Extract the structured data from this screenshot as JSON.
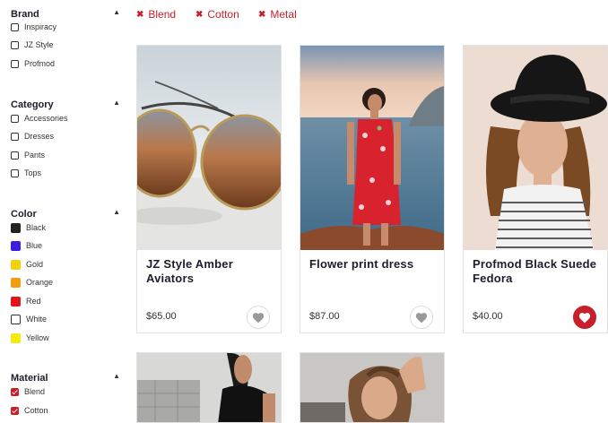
{
  "filters_chips": [
    "Blend",
    "Cotton",
    "Metal"
  ],
  "sidebar": {
    "brand": {
      "title": "Brand",
      "options": [
        {
          "label": "Inspiracy",
          "checked": false
        },
        {
          "label": "JZ Style",
          "checked": false
        },
        {
          "label": "Profmod",
          "checked": false
        }
      ]
    },
    "category": {
      "title": "Category",
      "options": [
        {
          "label": "Accessories",
          "checked": false
        },
        {
          "label": "Dresses",
          "checked": false
        },
        {
          "label": "Pants",
          "checked": false
        },
        {
          "label": "Tops",
          "checked": false
        }
      ]
    },
    "color": {
      "title": "Color",
      "options": [
        {
          "label": "Black",
          "swatch": "#222222"
        },
        {
          "label": "Blue",
          "swatch": "#3a1fe0"
        },
        {
          "label": "Gold",
          "swatch": "#f2d20a"
        },
        {
          "label": "Orange",
          "swatch": "#f39c12"
        },
        {
          "label": "Red",
          "swatch": "#e3141b"
        },
        {
          "label": "White",
          "swatch": "#ffffff"
        },
        {
          "label": "Yellow",
          "swatch": "#f5ea0c"
        }
      ]
    },
    "material": {
      "title": "Material",
      "options": [
        {
          "label": "Blend",
          "checked": true
        },
        {
          "label": "Cotton",
          "checked": true
        }
      ]
    }
  },
  "products": [
    {
      "title": "JZ Style Amber Aviators",
      "price": "$65.00",
      "favorited": false,
      "image": "sunglasses-photo"
    },
    {
      "title": "Flower print dress",
      "price": "$87.00",
      "favorited": false,
      "image": "flower-dress-photo"
    },
    {
      "title": "Profmod Black Suede Fedora",
      "price": "$40.00",
      "favorited": true,
      "image": "fedora-photo"
    }
  ],
  "partial_products": [
    {
      "image": "black-top-photo"
    },
    {
      "image": "model-portrait-photo"
    }
  ],
  "colors": {
    "accent": "#c7202a",
    "heart_inactive": "#999999"
  }
}
